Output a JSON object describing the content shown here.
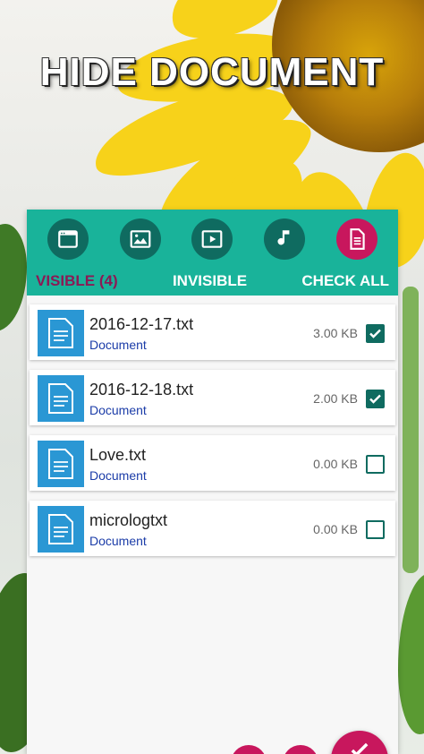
{
  "hero": {
    "title": "HIDE DOCUMENT"
  },
  "categories": [
    {
      "name": "app-icon",
      "active": false
    },
    {
      "name": "image-icon",
      "active": false
    },
    {
      "name": "video-icon",
      "active": false
    },
    {
      "name": "music-note-icon",
      "active": false
    },
    {
      "name": "document-icon",
      "active": true
    }
  ],
  "tabs": {
    "visible": "VISIBLE (4)",
    "invisible": "INVISIBLE",
    "check_all": "CHECK ALL"
  },
  "files": [
    {
      "name": "2016-12-17.txt",
      "type": "Document",
      "size": "3.00 KB",
      "checked": true
    },
    {
      "name": "2016-12-18.txt",
      "type": "Document",
      "size": "2.00 KB",
      "checked": true
    },
    {
      "name": "Love.txt",
      "type": "Document",
      "size": "0.00 KB",
      "checked": false
    },
    {
      "name": "micrologtxt",
      "type": "Document",
      "size": "0.00 KB",
      "checked": false
    }
  ],
  "colors": {
    "header": "#19b39a",
    "accent": "#c8175d",
    "active_tab": "#8b1a55",
    "checkbox": "#0f6b60",
    "file_icon": "#2a97d4",
    "doc_type": "#1b3ca8"
  }
}
